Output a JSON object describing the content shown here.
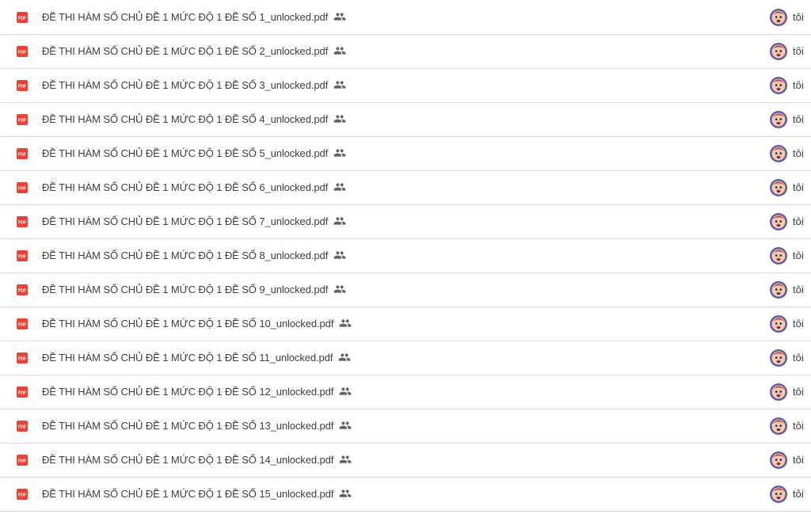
{
  "files": [
    {
      "name": "ĐỀ THI HÀM SỐ CHỦ ĐỀ 1 MỨC ĐỘ 1 ĐỀ SỐ 1_unlocked.pdf",
      "owner": "tôi"
    },
    {
      "name": "ĐỀ THI HÀM SỐ CHỦ ĐỀ 1 MỨC ĐỘ 1 ĐỀ SỐ 2_unlocked.pdf",
      "owner": "tôi"
    },
    {
      "name": "ĐỀ THI HÀM SỐ CHỦ ĐỀ 1 MỨC ĐỘ 1 ĐỀ SỐ 3_unlocked.pdf",
      "owner": "tôi"
    },
    {
      "name": "ĐỀ THI HÀM SỐ CHỦ ĐỀ 1 MỨC ĐỘ 1 ĐỀ SỐ 4_unlocked.pdf",
      "owner": "tôi"
    },
    {
      "name": "ĐỀ THI HÀM SỐ CHỦ ĐỀ 1 MỨC ĐỘ 1 ĐỀ SỐ 5_unlocked.pdf",
      "owner": "tôi"
    },
    {
      "name": "ĐỀ THI HÀM SỐ CHỦ ĐỀ 1 MỨC ĐỘ 1 ĐỀ SỐ 6_unlocked.pdf",
      "owner": "tôi"
    },
    {
      "name": "ĐỀ THI HÀM SỐ CHỦ ĐỀ 1 MỨC ĐỘ 1 ĐỀ SỐ 7_unlocked.pdf",
      "owner": "tôi"
    },
    {
      "name": "ĐỀ THI HÀM SỐ CHỦ ĐỀ 1 MỨC ĐỘ 1 ĐỀ SỐ 8_unlocked.pdf",
      "owner": "tôi"
    },
    {
      "name": "ĐỀ THI HÀM SỐ CHỦ ĐỀ 1 MỨC ĐỘ 1 ĐỀ SỐ 9_unlocked.pdf",
      "owner": "tôi"
    },
    {
      "name": "ĐỀ THI HÀM SỐ CHỦ ĐỀ 1 MỨC ĐỘ 1 ĐỀ SỐ 10_unlocked.pdf",
      "owner": "tôi"
    },
    {
      "name": "ĐỀ THI HÀM SỐ CHỦ ĐỀ 1 MỨC ĐỘ 1 ĐỀ SỐ 11_unlocked.pdf",
      "owner": "tôi"
    },
    {
      "name": "ĐỀ THI HÀM SỐ CHỦ ĐỀ 1 MỨC ĐỘ 1 ĐỀ SỐ 12_unlocked.pdf",
      "owner": "tôi"
    },
    {
      "name": "ĐỀ THI HÀM SỐ CHỦ ĐỀ 1 MỨC ĐỘ 1 ĐỀ SỐ 13_unlocked.pdf",
      "owner": "tôi"
    },
    {
      "name": "ĐỀ THI HÀM SỐ CHỦ ĐỀ 1 MỨC ĐỘ 1 ĐỀ SỐ 14_unlocked.pdf",
      "owner": "tôi"
    },
    {
      "name": "ĐỀ THI HÀM SỐ CHỦ ĐỀ 1 MỨC ĐỘ 1 ĐỀ SỐ 15_unlocked.pdf",
      "owner": "tôi"
    }
  ],
  "icons": {
    "file_type": "pdf-icon",
    "shared": "shared-people-icon",
    "owner_avatar": "avatar"
  },
  "colors": {
    "pdf_red": "#ea4335",
    "text": "#3c4043",
    "divider": "#dadce0",
    "shared_icon": "#5f6368",
    "avatar_ring": "#5b5ea6"
  }
}
